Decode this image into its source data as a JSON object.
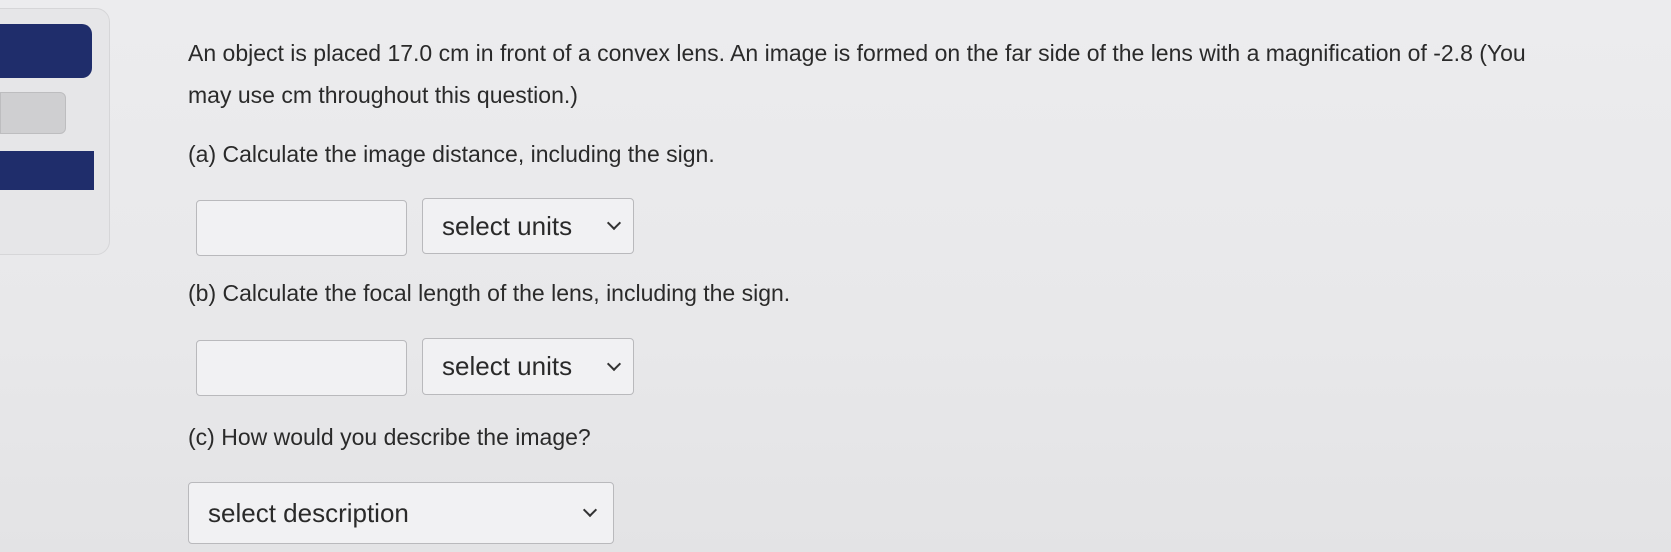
{
  "question": {
    "line1": "An object is placed 17.0 cm in front of a convex lens. An image is formed on the far side of the lens with a magnification of -2.8  (You",
    "line2": "may use cm throughout this question.)",
    "part_a": "(a) Calculate the image distance, including the sign.",
    "part_b": "(b) Calculate the focal length of the lens, including the sign.",
    "part_c": "(c) How would you describe the image?"
  },
  "answers": {
    "a": {
      "value": "",
      "units_selected": "select units"
    },
    "b": {
      "value": "",
      "units_selected": "select units"
    },
    "c": {
      "description_selected": "select description"
    }
  },
  "icons": {
    "dropdown": "chevron-down-icon"
  },
  "colors": {
    "nav_accent": "#1f2d6b",
    "background": "#ececee",
    "border": "#b9b9bc"
  }
}
